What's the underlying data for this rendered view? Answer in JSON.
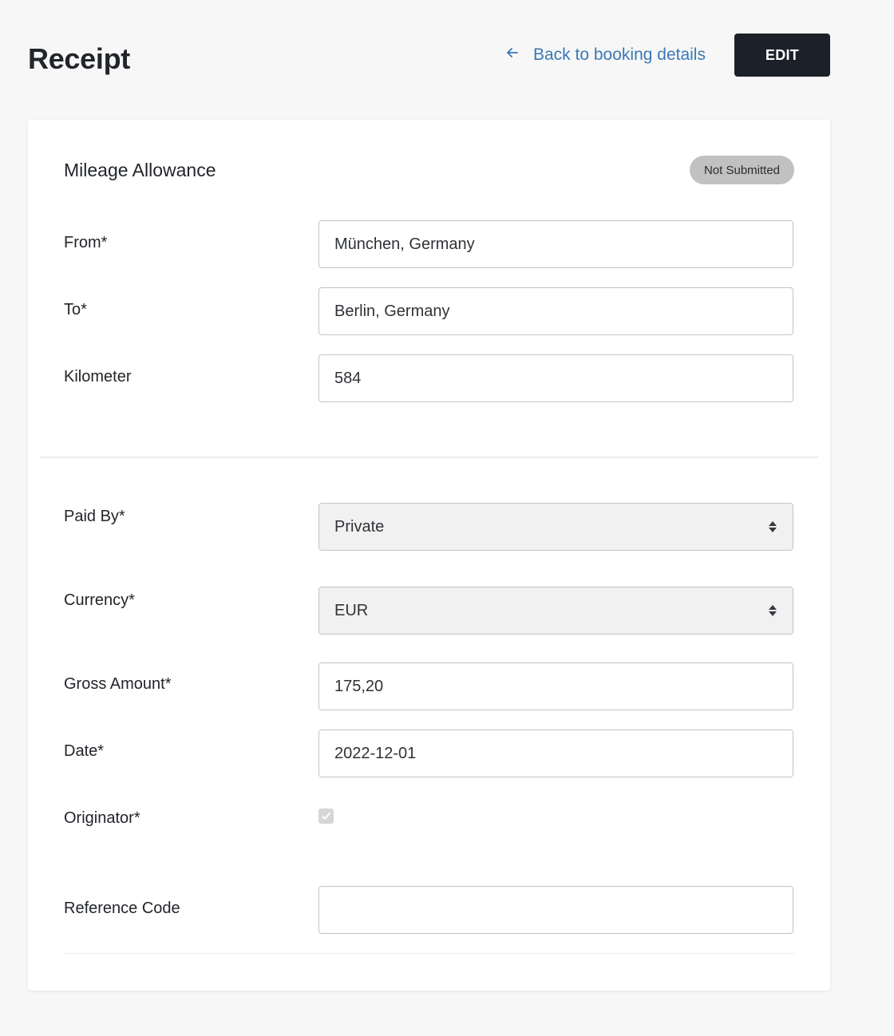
{
  "header": {
    "title": "Receipt",
    "back_link": "Back to booking details",
    "back_icon": "arrow-left-icon",
    "edit_label": "EDIT"
  },
  "card": {
    "title": "Mileage Allowance",
    "status": "Not Submitted",
    "fields": {
      "from": {
        "label": "From*",
        "value": "München, Germany"
      },
      "to": {
        "label": "To*",
        "value": "Berlin, Germany"
      },
      "kilometer": {
        "label": "Kilometer",
        "value": "584"
      },
      "paid_by": {
        "label": "Paid By*",
        "value": "Private"
      },
      "currency": {
        "label": "Currency*",
        "value": "EUR"
      },
      "gross_amount": {
        "label": "Gross Amount*",
        "value": "175,20"
      },
      "date": {
        "label": "Date*",
        "value": "2022-12-01"
      },
      "originator": {
        "label": "Originator*",
        "checked": true
      },
      "reference_code": {
        "label": "Reference Code",
        "value": ""
      }
    }
  },
  "colors": {
    "link": "#3b78b5",
    "edit_button_bg": "#1c2129",
    "badge_bg": "#c1c1c1",
    "page_bg": "#f7f7f7"
  }
}
